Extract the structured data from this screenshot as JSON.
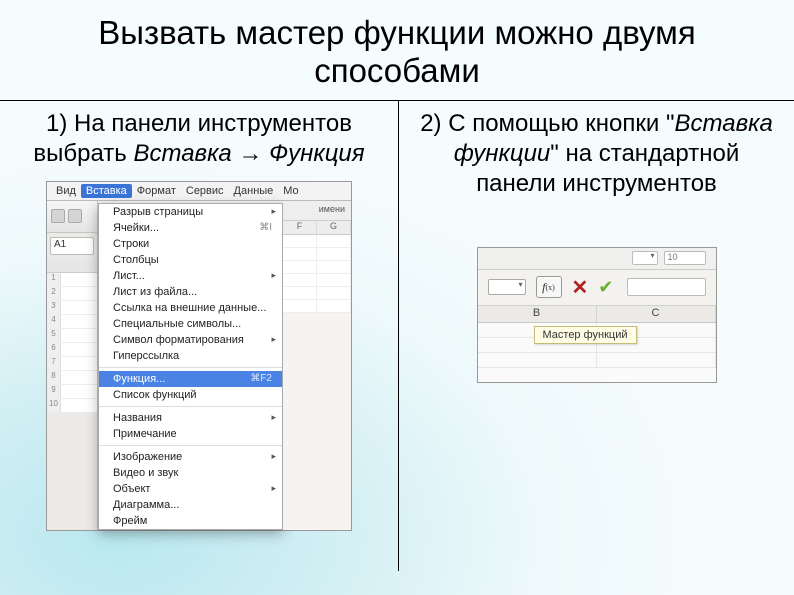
{
  "title": "Вызвать мастер функции можно двумя способами",
  "left": {
    "desc_pre": "1) На панели инструментов выбрать ",
    "desc_ital": "Вставка → Функция",
    "menubar": [
      "Вид",
      "Вставка",
      "Формат",
      "Сервис",
      "Данные",
      "Mo"
    ],
    "active_ref": "A1",
    "namebox_label": "имени",
    "cols": [
      "F",
      "G"
    ],
    "dropdown": {
      "groups": [
        [
          {
            "label": "Разрыв страницы",
            "arrow": true
          },
          {
            "label": "Ячейки...",
            "shortcut": "⌘I"
          },
          {
            "label": "Строки"
          },
          {
            "label": "Столбцы"
          },
          {
            "label": "Лист...",
            "arrow": true
          },
          {
            "label": "Лист из файла..."
          },
          {
            "label": "Ссылка на внешние данные..."
          },
          {
            "label": "Специальные символы..."
          },
          {
            "label": "Символ форматирования",
            "arrow": true
          },
          {
            "label": "Гиперссылка"
          }
        ],
        [
          {
            "label": "Функция...",
            "shortcut": "⌘F2",
            "selected": true
          },
          {
            "label": "Список функций"
          }
        ],
        [
          {
            "label": "Названия",
            "arrow": true
          },
          {
            "label": "Примечание"
          }
        ],
        [
          {
            "label": "Изображение",
            "arrow": true
          },
          {
            "label": "Видео и звук"
          },
          {
            "label": "Объект",
            "arrow": true
          },
          {
            "label": "Диаграмма..."
          },
          {
            "label": "Фрейм"
          }
        ]
      ]
    }
  },
  "right": {
    "desc_pre": "2) С помощью кнопки \"",
    "desc_ital": "Вставка функции",
    "desc_post": "\" на стандартной панели инструментов",
    "fx_label": "f",
    "fx_sub": "(x)",
    "font_size": "10",
    "columns": [
      "B",
      "C"
    ],
    "tooltip": "Мастер функций"
  }
}
